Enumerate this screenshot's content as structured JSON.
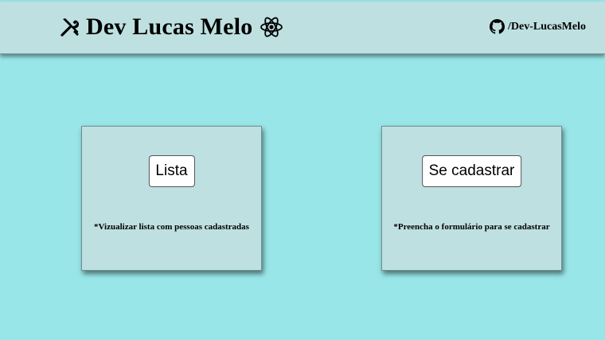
{
  "header": {
    "title": "Dev Lucas Melo",
    "left_icon": "tools-icon",
    "right_icon": "react-atom-icon",
    "github": {
      "icon": "github-icon",
      "label": "/Dev-LucasMelo"
    }
  },
  "cards": [
    {
      "button_label": "Lista",
      "description": "*Vizualizar lista com pessoas cadastradas"
    },
    {
      "button_label": "Se cadastrar",
      "description": "*Preencha o formulário para se cadastrar"
    }
  ],
  "colors": {
    "page_background": "#98e6e8",
    "header_background": "#bfe0e1",
    "card_background": "#bfe0e1",
    "button_background": "#ffffff"
  }
}
